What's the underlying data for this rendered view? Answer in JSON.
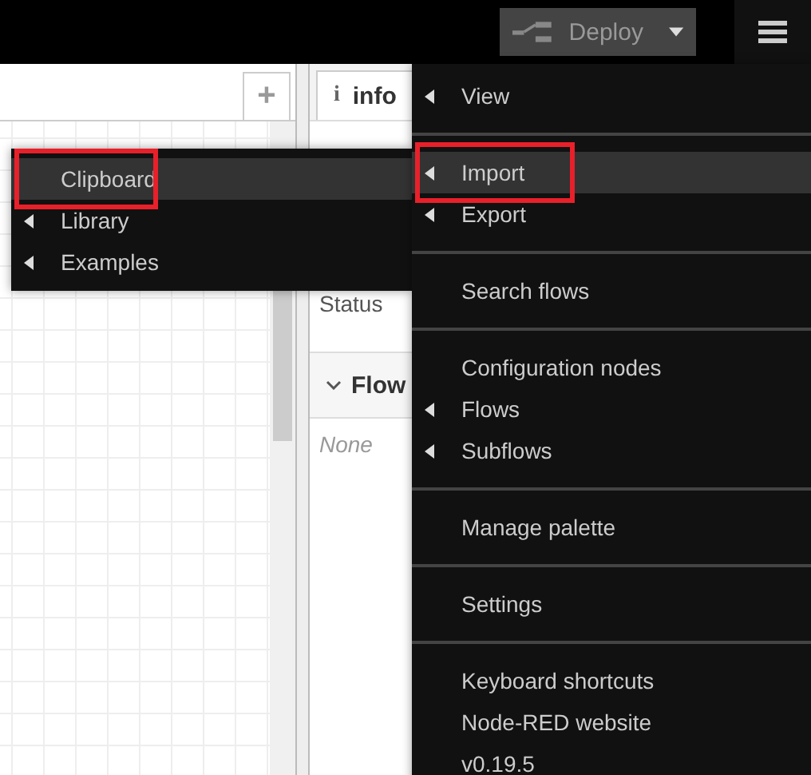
{
  "header": {
    "deploy": {
      "label": "Deploy"
    }
  },
  "workspace": {
    "add_tab": "+"
  },
  "sidebar": {
    "tab": {
      "label": "info",
      "icon": "i"
    },
    "status_label": "Status",
    "section": {
      "title": "Flow",
      "expanded": true
    },
    "empty_text": "None"
  },
  "main_menu": [
    [
      {
        "label": "View",
        "submenu": true,
        "selected": false
      }
    ],
    [
      {
        "label": "Import",
        "submenu": true,
        "selected": true
      },
      {
        "label": "Export",
        "submenu": true,
        "selected": false
      }
    ],
    [
      {
        "label": "Search flows",
        "submenu": false,
        "selected": false
      }
    ],
    [
      {
        "label": "Configuration nodes",
        "submenu": false,
        "selected": false
      },
      {
        "label": "Flows",
        "submenu": true,
        "selected": false
      },
      {
        "label": "Subflows",
        "submenu": true,
        "selected": false
      }
    ],
    [
      {
        "label": "Manage palette",
        "submenu": false,
        "selected": false
      }
    ],
    [
      {
        "label": "Settings",
        "submenu": false,
        "selected": false
      }
    ],
    [
      {
        "label": "Keyboard shortcuts",
        "submenu": false,
        "selected": false
      },
      {
        "label": "Node-RED website",
        "submenu": false,
        "selected": false
      },
      {
        "label": "v0.19.5",
        "submenu": false,
        "selected": false
      }
    ]
  ],
  "import_submenu": [
    {
      "label": "Clipboard",
      "submenu": false,
      "selected": true
    },
    {
      "label": "Library",
      "submenu": true,
      "selected": false
    },
    {
      "label": "Examples",
      "submenu": true,
      "selected": false
    }
  ]
}
